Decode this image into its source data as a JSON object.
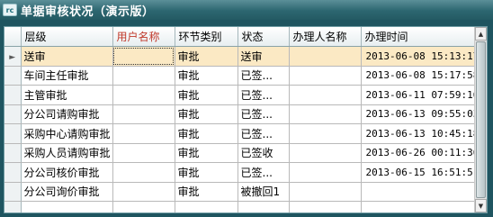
{
  "window": {
    "title": "单据审核状况（演示版）",
    "icon": "app-logo-icon",
    "icon_text": "rc"
  },
  "table": {
    "headers": [
      "层级",
      "用户名称",
      "环节类别",
      "状态",
      "办理人名称",
      "办理时间"
    ],
    "rows": [
      [
        "送审",
        "",
        "审批",
        "送审",
        "",
        "2013-06-08 15:13:17"
      ],
      [
        "车间主任审批",
        "",
        "审批",
        "已签...",
        "",
        "2013-06-08 15:17:58"
      ],
      [
        "主管审批",
        "",
        "审批",
        "已签...",
        "",
        "2013-06-11 07:59:16"
      ],
      [
        "分公司请购审批",
        "",
        "审批",
        "已签...",
        "",
        "2013-06-13 09:55:03"
      ],
      [
        "采购中心请购审批",
        "",
        "审批",
        "已签...",
        "",
        "2013-06-13 10:45:18"
      ],
      [
        "采购人员请购审批",
        "",
        "审批",
        "已签收",
        "",
        "2013-06-26 00:11:36"
      ],
      [
        "分公司核价审批",
        "",
        "审批",
        "已签...",
        "",
        "2013-06-15 16:51:51"
      ],
      [
        "分公司询价审批",
        "",
        "审批",
        "被撤回1",
        "",
        ""
      ],
      [
        "",
        "",
        "",
        "",
        "",
        ""
      ]
    ],
    "selected_row_indicator": "►"
  },
  "colors": {
    "selected_row": "#fbe9c4",
    "highlight_header": "#c0392b",
    "titlebar": "#2c6670"
  }
}
